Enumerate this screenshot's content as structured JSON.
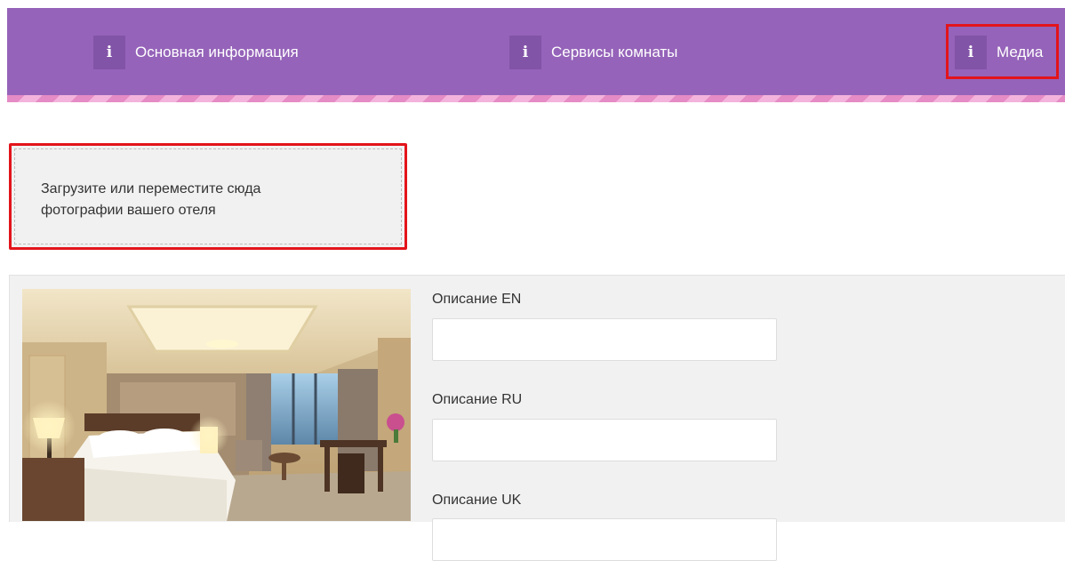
{
  "tabs": {
    "basic": {
      "icon": "info-icon",
      "icon_glyph": "i",
      "label": "Основная информация"
    },
    "services": {
      "icon": "info-icon",
      "icon_glyph": "i",
      "label": "Сервисы комнаты"
    },
    "media": {
      "icon": "info-icon",
      "icon_glyph": "i",
      "label": "Медиа"
    }
  },
  "upload": {
    "text": "Загрузите или переместите сюда фотографии вашего отеля"
  },
  "photo": {
    "icon": "hotel-room-photo"
  },
  "fields": {
    "desc_en": {
      "label": "Описание EN",
      "value": ""
    },
    "desc_ru": {
      "label": "Описание RU",
      "value": ""
    },
    "desc_uk": {
      "label": "Описание UK",
      "value": ""
    }
  },
  "colors": {
    "header": "#9563b9",
    "icon_bg": "#8254a8",
    "highlight": "#e3141b",
    "stripe": "#e58bc5"
  }
}
